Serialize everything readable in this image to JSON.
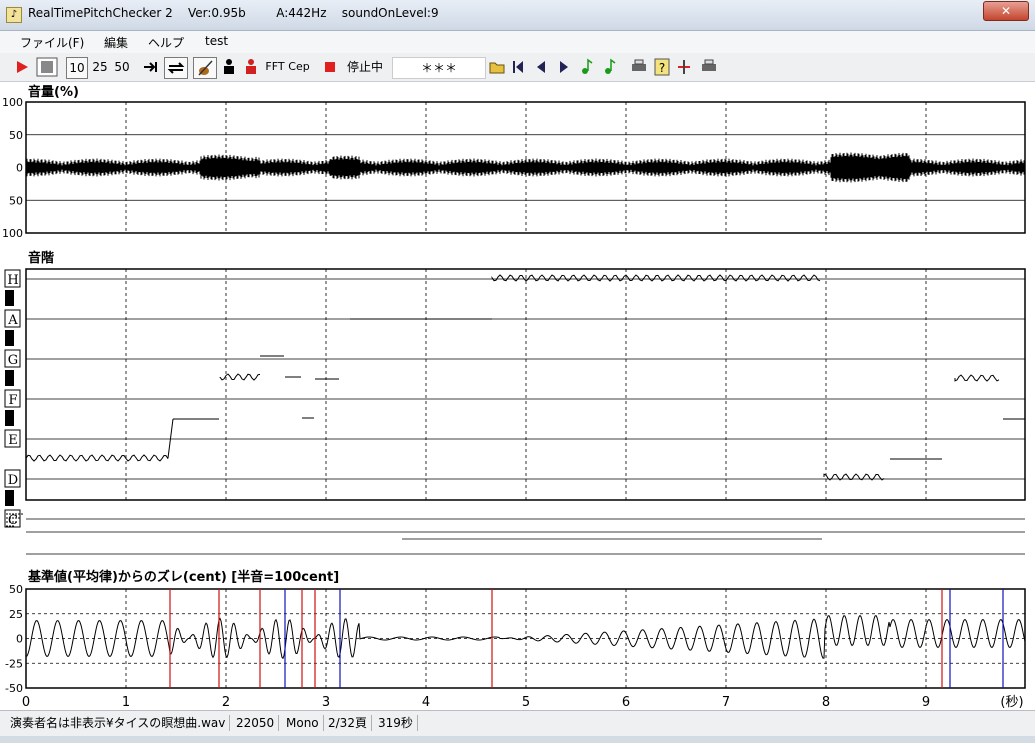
{
  "window": {
    "title": "RealTimePitchChecker 2    Ver:0.95b        A:442Hz    soundOnLevel:9",
    "close_label": "✕"
  },
  "menu": [
    "ファイル(F)",
    "編集",
    "ヘルプ",
    "test"
  ],
  "toolbar": {
    "speed_options": [
      "10",
      "25",
      "50"
    ],
    "fft_label": "FFT",
    "cep_label": "Cep",
    "status_text": "停止中",
    "display_text": "＊＊＊",
    "accent_red": "#e02020"
  },
  "panels": {
    "volume": {
      "title": "音量(%)",
      "ticks": [
        "100",
        "50",
        "0",
        "50",
        "100"
      ]
    },
    "scale": {
      "title": "音階",
      "notes": [
        "H",
        "A",
        "G",
        "F",
        "E",
        "D",
        "C"
      ]
    },
    "cent": {
      "title": "基準値(平均律)からのズレ(cent) [半音=100cent]",
      "ticks": [
        "50",
        "25",
        "0",
        "-25",
        "-50"
      ]
    }
  },
  "time_axis": {
    "ticks": [
      "0",
      "1",
      "2",
      "3",
      "4",
      "5",
      "6",
      "7",
      "8",
      "9"
    ],
    "unit": "(秒)"
  },
  "status": {
    "file": "演奏者名は非表示¥タイスの瞑想曲.wav",
    "rate": "22050",
    "channels": "Mono",
    "page": "2/32頁",
    "duration": "319秒"
  }
}
